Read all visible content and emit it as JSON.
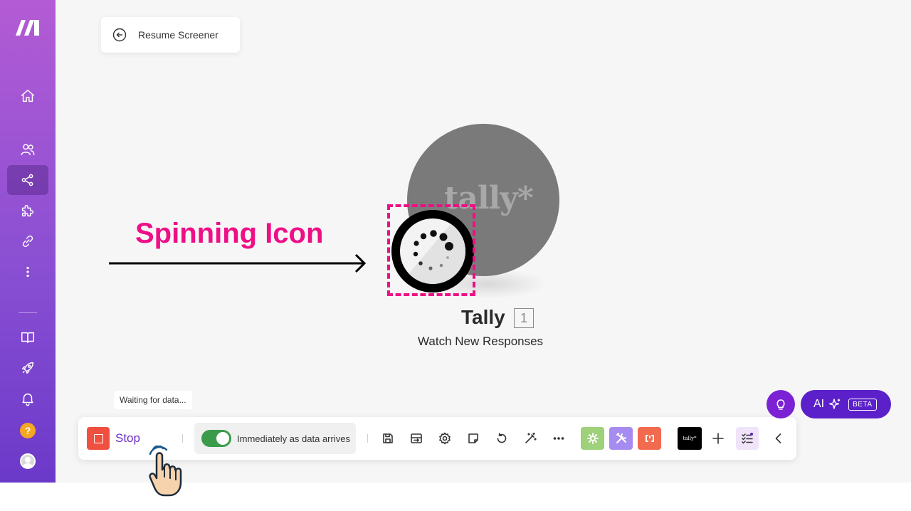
{
  "sidebar": {
    "logo": "make-logo",
    "items": [
      {
        "name": "home",
        "icon": "home-icon"
      },
      {
        "name": "team",
        "icon": "users-icon"
      },
      {
        "name": "scenarios",
        "icon": "share-nodes-icon",
        "active": true
      },
      {
        "name": "apps",
        "icon": "puzzle-icon"
      },
      {
        "name": "connections",
        "icon": "link-icon"
      },
      {
        "name": "more",
        "icon": "more-vertical-icon"
      },
      {
        "name": "docs",
        "icon": "book-icon"
      },
      {
        "name": "launch",
        "icon": "rocket-icon"
      },
      {
        "name": "notifications",
        "icon": "bell-icon"
      },
      {
        "name": "help",
        "icon": "help-icon",
        "text": "?"
      },
      {
        "name": "profile",
        "icon": "avatar-icon"
      }
    ]
  },
  "header": {
    "back_label": "Resume Screener"
  },
  "annotation": {
    "title": "Spinning Icon",
    "color": "#ee0f86"
  },
  "module": {
    "app_logo_text": "tally*",
    "name": "Tally",
    "number": "1",
    "subtitle": "Watch New Responses"
  },
  "status": {
    "tooltip": "Waiting for data..."
  },
  "toolbar": {
    "stop_label": "Stop",
    "schedule_label": "Immediately as data arrives",
    "schedule_enabled": true,
    "icons": [
      "save-icon",
      "explain-flow-icon",
      "settings-icon",
      "notes-icon",
      "history-icon",
      "magic-wand-icon",
      "more-icon"
    ],
    "tools": [
      {
        "icon": "gear-icon",
        "color": "#9fd07a"
      },
      {
        "icon": "tools-icon",
        "color": "#a68bf0"
      },
      {
        "icon": "text-parser-icon",
        "color": "#f26b4f"
      }
    ],
    "tally_label": "tally*",
    "add_icon": "plus-icon",
    "list_icon": "checklist-icon",
    "collapse_icon": "chevron-left-icon"
  },
  "assistant": {
    "ai_label": "AI",
    "beta_label": "BETA"
  },
  "colors": {
    "accent": "#6d2fc4",
    "stop": "#f0503f",
    "toggle_on": "#3b9b4a"
  }
}
